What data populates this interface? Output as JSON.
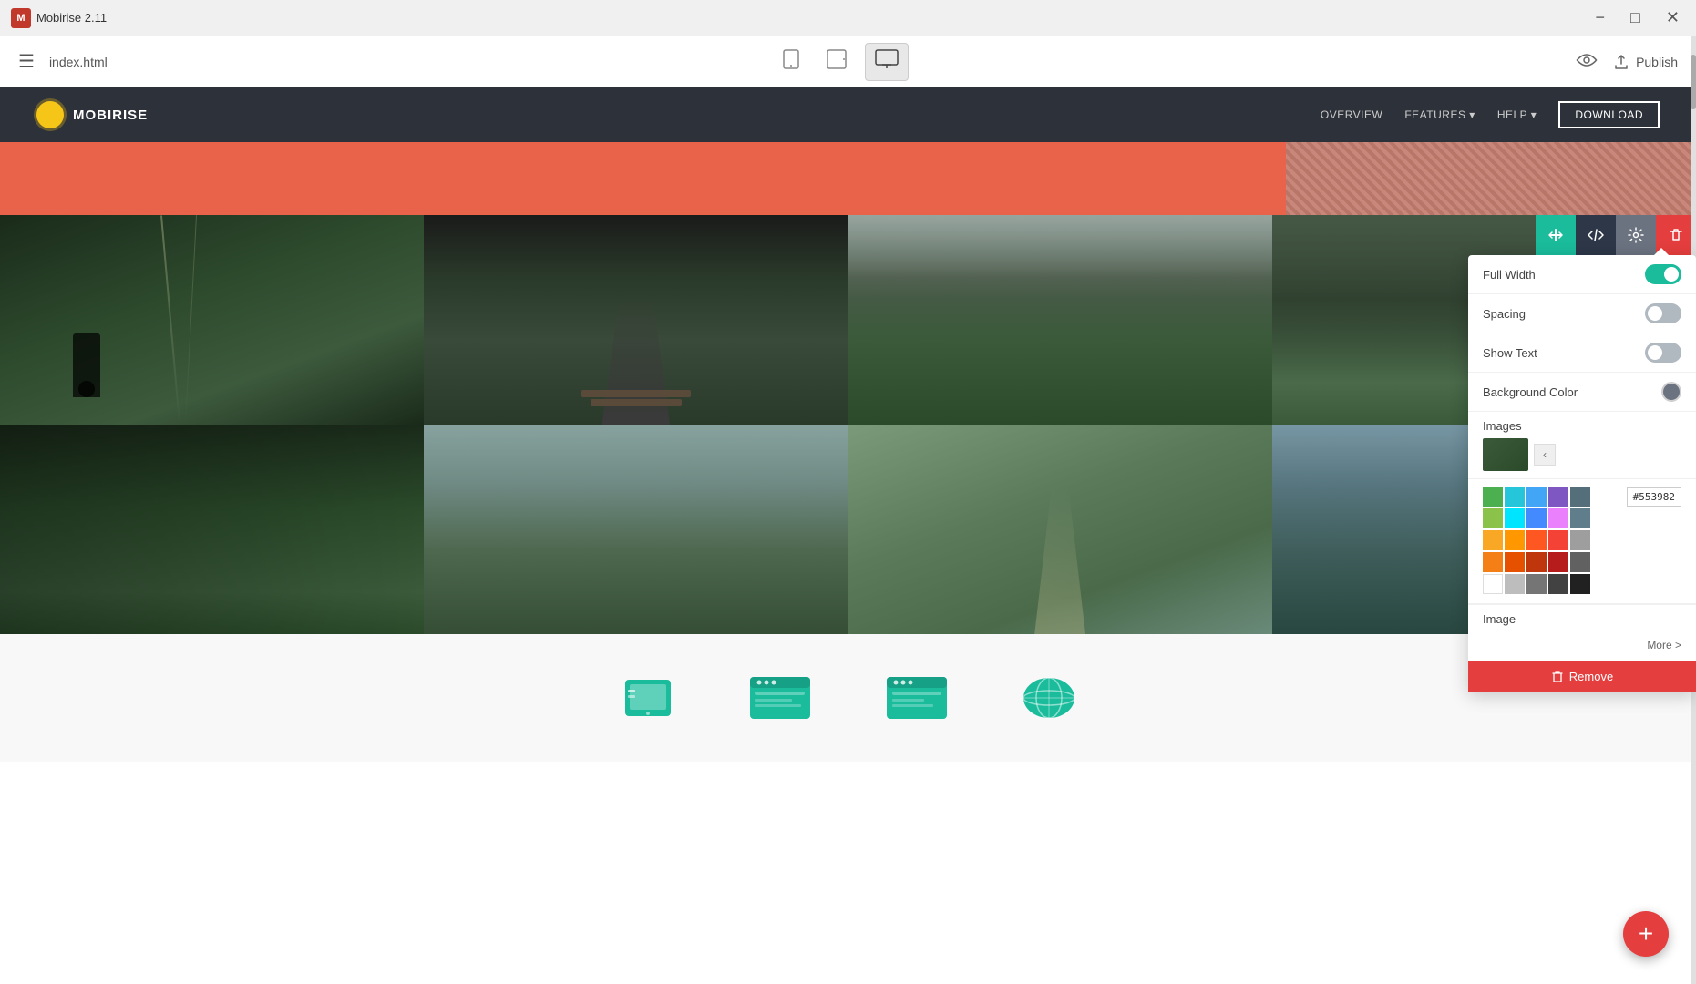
{
  "titleBar": {
    "appName": "Mobirise 2.11",
    "logoText": "M",
    "minimize": "−",
    "maximize": "□",
    "close": "✕"
  },
  "appBar": {
    "filename": "index.html",
    "publishLabel": "Publish"
  },
  "preview": {
    "navbar": {
      "brand": "MOBIRISE",
      "links": [
        "OVERVIEW",
        "FEATURES",
        "HELP"
      ],
      "downloadBtn": "DOWNLOAD"
    },
    "settings": {
      "fullWidthLabel": "Full Width",
      "spacingLabel": "Spacing",
      "showTextLabel": "Show Text",
      "backgroundColorLabel": "Background Color",
      "imagesLabel": "Images",
      "imageLabel": "Image",
      "moreLink": "More >",
      "removeLabel": "Remove",
      "hexColor": "#553982"
    },
    "palette": {
      "colors": [
        "#4caf50",
        "#00bcd4",
        "#2196f3",
        "#9c27b0",
        "#607d8b",
        "#8bc34a",
        "#00e5ff",
        "#448aff",
        "#ea80fc",
        "#546e7a",
        "#f9a825",
        "#ff9800",
        "#ff5722",
        "#f44336",
        "#9e9e9e",
        "#f57f17",
        "#e65100",
        "#bf360c",
        "#b71c1c",
        "#616161",
        "#ffffff",
        "#bdbdbd",
        "#757575",
        "#424242",
        "#000000"
      ]
    }
  },
  "fab": {
    "label": "+"
  },
  "toolbar": {
    "rearrangeTitle": "Rearrange",
    "codeTitle": "Code",
    "settingsTitle": "Settings",
    "deleteTitle": "Delete"
  }
}
